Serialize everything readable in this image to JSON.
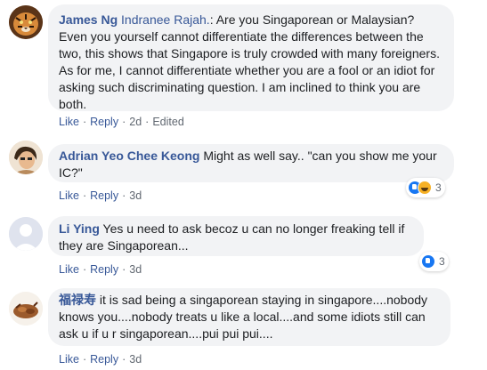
{
  "comments": [
    {
      "author": "James Ng",
      "mention": "Indranee Rajah.",
      "text": ": Are you Singaporean or Malaysian? Even you yourself cannot differentiate the differences between the two, this shows that Singapore is truly crowded with many foreigners. As for me, I cannot differentiate whether you are a fool or an idiot for asking such discriminating question. I am inclined to think you are both.",
      "like": "Like",
      "reply": "Reply",
      "time": "2d",
      "edited": "Edited"
    },
    {
      "author": "Adrian Yeo Chee Keong",
      "text": "Might as well say.. \"can you show me your IC?\"",
      "like": "Like",
      "reply": "Reply",
      "time": "3d",
      "reaction_count": "3",
      "reaction_icons": [
        "like-icon",
        "haha-icon"
      ]
    },
    {
      "author": "Li Ying",
      "text": "Yes u need to ask becoz u can no longer freaking tell if they are Singaporean...",
      "like": "Like",
      "reply": "Reply",
      "time": "3d",
      "reaction_count": "3",
      "reaction_icons": [
        "like-icon"
      ]
    },
    {
      "author": "福禄寿",
      "text": "it is sad being a singaporean staying in singapore....nobody knows you....nobody treats u like a local....and some idiots still can ask u if u r singaporean....pui pui pui....",
      "like": "Like",
      "reply": "Reply",
      "time": "3d"
    }
  ],
  "colors": {
    "author": "#385898",
    "bubble": "#f2f3f5",
    "text": "#1c1e21",
    "meta": "#606770",
    "like_reaction": "#1877f2",
    "haha_reaction": "#f7b125"
  }
}
